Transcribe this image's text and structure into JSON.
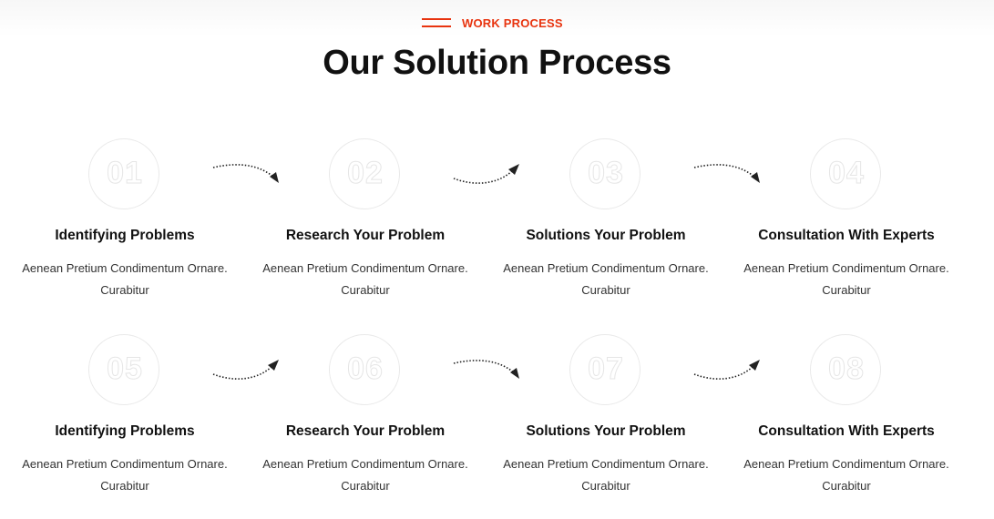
{
  "eyebrow": "WORK PROCESS",
  "title": "Our Solution Process",
  "accent_color": "#e8340f",
  "steps": [
    {
      "number": "01",
      "heading": "Identifying Problems",
      "description": "Aenean Pretium Condimentum Ornare. Curabitur"
    },
    {
      "number": "02",
      "heading": "Research Your Problem",
      "description": "Aenean Pretium Condimentum Ornare. Curabitur"
    },
    {
      "number": "03",
      "heading": "Solutions Your Problem",
      "description": "Aenean Pretium Condimentum Ornare. Curabitur"
    },
    {
      "number": "04",
      "heading": "Consultation With Experts",
      "description": "Aenean Pretium Condimentum Ornare. Curabitur"
    },
    {
      "number": "05",
      "heading": "Identifying Problems",
      "description": "Aenean Pretium Condimentum Ornare. Curabitur"
    },
    {
      "number": "06",
      "heading": "Research Your Problem",
      "description": "Aenean Pretium Condimentum Ornare. Curabitur"
    },
    {
      "number": "07",
      "heading": "Solutions Your Problem",
      "description": "Aenean Pretium Condimentum Ornare. Curabitur"
    },
    {
      "number": "08",
      "heading": "Consultation With Experts",
      "description": "Aenean Pretium Condimentum Ornare. Curabitur"
    }
  ],
  "arrows": [
    {
      "icon": "curved-arrow-down-right-icon"
    },
    {
      "icon": "curved-arrow-up-right-icon"
    },
    {
      "icon": "curved-arrow-down-right-icon"
    },
    {
      "icon": "curved-arrow-up-right-icon"
    },
    {
      "icon": "curved-arrow-down-right-icon"
    },
    {
      "icon": "curved-arrow-up-right-icon"
    }
  ]
}
